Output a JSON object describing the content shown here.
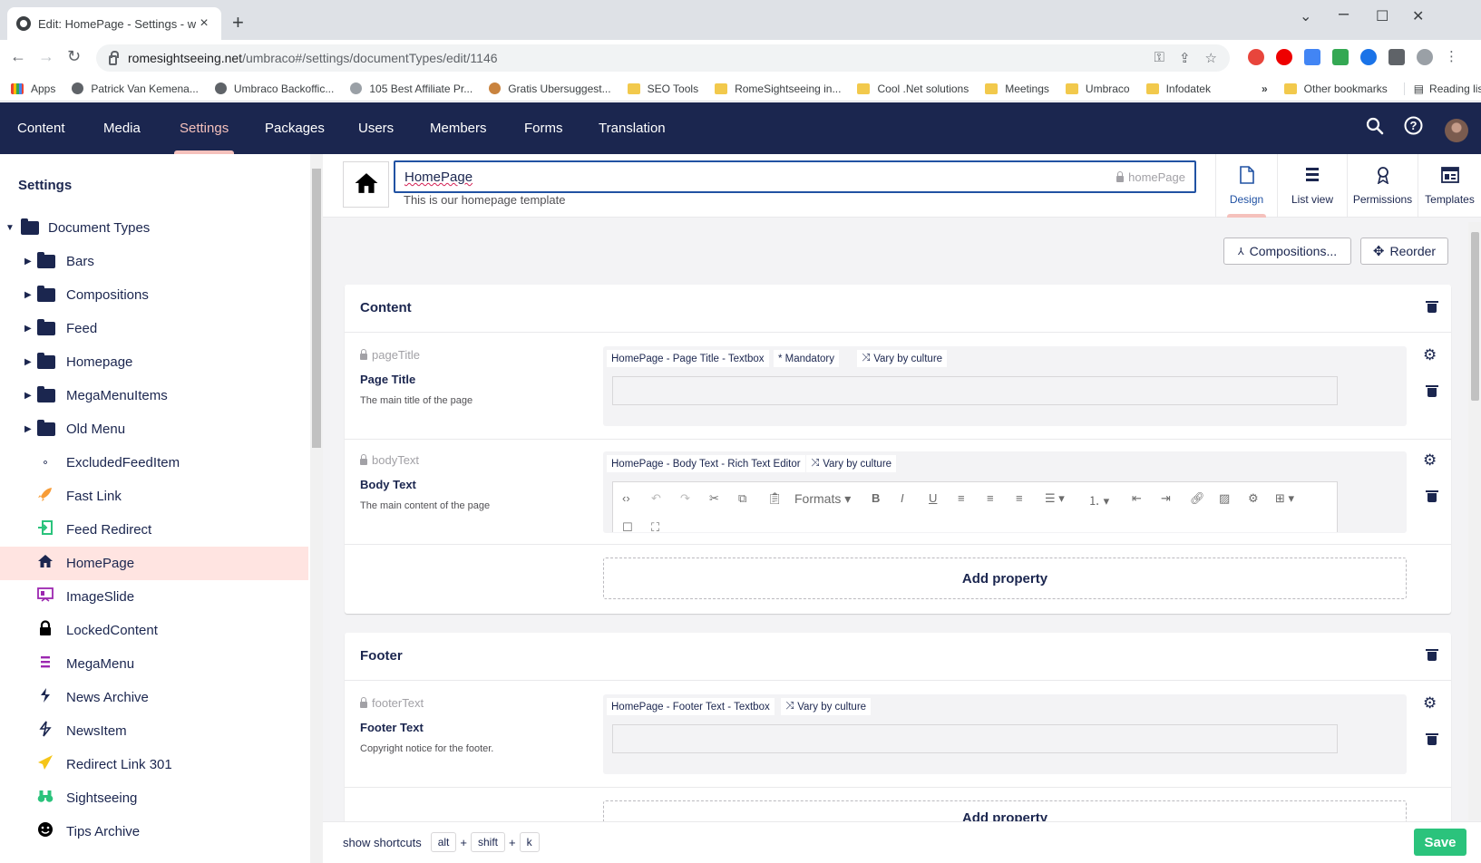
{
  "browser": {
    "tab_title": "Edit: HomePage - Settings - www",
    "url_host": "romesightseeing.net",
    "url_path": "/umbraco#/settings/documentTypes/edit/1146",
    "bookmarks": [
      {
        "label": "Apps",
        "icon": "apps-grid-icon"
      },
      {
        "label": "Patrick Van Kemena...",
        "icon": "site-icon"
      },
      {
        "label": "Umbraco Backoffic...",
        "icon": "site-icon"
      },
      {
        "label": "105 Best Affiliate Pr...",
        "icon": "site-icon"
      },
      {
        "label": "Gratis Ubersuggest...",
        "icon": "site-icon"
      },
      {
        "label": "SEO Tools",
        "icon": "folder-icon"
      },
      {
        "label": "RomeSightseeing in...",
        "icon": "folder-icon"
      },
      {
        "label": "Cool .Net solutions",
        "icon": "folder-icon"
      },
      {
        "label": "Meetings",
        "icon": "folder-icon"
      },
      {
        "label": "Umbraco",
        "icon": "folder-icon"
      },
      {
        "label": "Infodatek",
        "icon": "folder-icon"
      }
    ],
    "more_bookmarks": "»",
    "other_bookmarks": "Other bookmarks",
    "reading_list": "Reading list"
  },
  "header": {
    "nav": [
      "Content",
      "Media",
      "Settings",
      "Packages",
      "Users",
      "Members",
      "Forms",
      "Translation"
    ],
    "active_section": "Settings"
  },
  "sidebar": {
    "title": "Settings",
    "root": "Document Types",
    "folders": [
      "Bars",
      "Compositions",
      "Feed",
      "Homepage",
      "MegaMenuItems",
      "Old Menu"
    ],
    "items": [
      {
        "label": "ExcludedFeedItem",
        "icon": "circle-dot-icon",
        "color": "#1b264f"
      },
      {
        "label": "Fast Link",
        "icon": "rocket-icon",
        "color": "#f79c37"
      },
      {
        "label": "Feed Redirect",
        "icon": "redirect-icon",
        "color": "#2bc37c"
      },
      {
        "label": "HomePage",
        "icon": "home-icon",
        "color": "#1b264f"
      },
      {
        "label": "ImageSlide",
        "icon": "slideshow-icon",
        "color": "#9c27b0"
      },
      {
        "label": "LockedContent",
        "icon": "lock-icon",
        "color": "#000000"
      },
      {
        "label": "MegaMenu",
        "icon": "menu-icon",
        "color": "#9c27b0"
      },
      {
        "label": "News Archive",
        "icon": "news-icon",
        "color": "#1b264f"
      },
      {
        "label": "NewsItem",
        "icon": "news-icon",
        "color": "#1b264f"
      },
      {
        "label": "Redirect Link 301",
        "icon": "paper-plane-icon",
        "color": "#f5c518"
      },
      {
        "label": "Sightseeing",
        "icon": "binoculars-icon",
        "color": "#2bc37c"
      },
      {
        "label": "Tips Archive",
        "icon": "smiley-icon",
        "color": "#000000"
      }
    ],
    "selected": "HomePage"
  },
  "editor": {
    "name": "HomePage",
    "alias": "homePage",
    "description": "This is our homepage template",
    "apps": [
      "Design",
      "List view",
      "Permissions",
      "Templates"
    ],
    "active_app": "Design",
    "compositions_label": "Compositions...",
    "reorder_label": "Reorder",
    "add_property_label": "Add property",
    "groups": [
      {
        "title": "Content",
        "properties": [
          {
            "alias": "pageTitle",
            "name": "Page Title",
            "description": "The main title of the page",
            "tags": [
              "HomePage - Page Title - Textbox",
              "* Mandatory",
              "Vary by culture"
            ]
          },
          {
            "alias": "bodyText",
            "name": "Body Text",
            "description": "The main content of the page",
            "tags": [
              "HomePage - Body Text - Rich Text Editor",
              "Vary by culture"
            ],
            "rte_formats": "Formats"
          }
        ]
      },
      {
        "title": "Footer",
        "properties": [
          {
            "alias": "footerText",
            "name": "Footer Text",
            "description": "Copyright notice for the footer.",
            "tags": [
              "HomePage - Footer Text - Textbox",
              "Vary by culture"
            ]
          }
        ]
      }
    ]
  },
  "footer": {
    "shortcuts_label": "show shortcuts",
    "keys": [
      "alt",
      "shift",
      "k"
    ],
    "plus": "+",
    "save_label": "Save"
  },
  "colors": {
    "header_bg": "#1b264f",
    "active_accent": "#f5c1bc",
    "selected_row": "#ffe4e1",
    "save_green": "#2bc37c",
    "input_focus": "#2152a3"
  }
}
